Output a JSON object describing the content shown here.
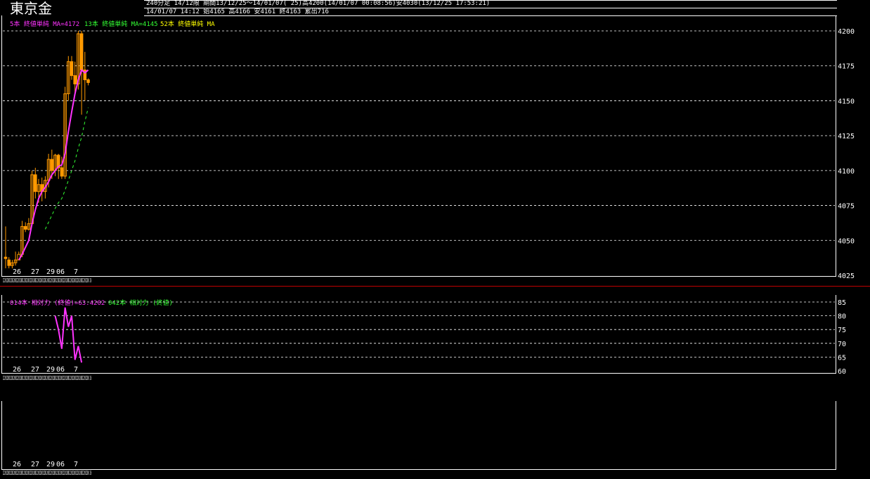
{
  "header": {
    "instrument": "東京金",
    "line1": "240分足 14/12限 期間13/12/25〜14/01/07( 25)高4200(14/01/07 00:08:56)安4030(13/12/25 17:53:21)",
    "line2": "14/01/07 14:12 始4165 高4166 安4161 終4163 累出716"
  },
  "legends": {
    "ma5": "5本 終値単純 MA=4172",
    "ma13": "13本 終値単純 MA=4145",
    "ma52": "52本 終値単純 MA",
    "rsi14": "014本 相対力 (終値)=63.4202",
    "rsi42": "042本 相対力 (終値)"
  },
  "colors": {
    "candle": "#ff9900",
    "ma5": "#ff33ff",
    "ma13": "#33ff33",
    "ma52": "#ffff00",
    "rsi14": "#ff33ff",
    "rsi42": "#33ff33",
    "grid": "#ffffff",
    "separator": "#c00000"
  },
  "date_labels": [
    "26",
    "27",
    "29",
    "06",
    "7"
  ],
  "time_labels": "12201208122012081220120812201208122012081220120812201208122012081220120812201208122012081220120812201208 26",
  "chart_data": [
    {
      "type": "candlestick",
      "title": "",
      "ylim": [
        4025,
        4210
      ],
      "yticks": [
        4025,
        4050,
        4075,
        4100,
        4125,
        4150,
        4175,
        4200
      ],
      "grid": true,
      "candles": [
        {
          "o": 4038,
          "h": 4060,
          "l": 4030,
          "c": 4037
        },
        {
          "o": 4036,
          "h": 4038,
          "l": 4030,
          "c": 4032
        },
        {
          "o": 4032,
          "h": 4036,
          "l": 4030,
          "c": 4034
        },
        {
          "o": 4034,
          "h": 4042,
          "l": 4032,
          "c": 4036
        },
        {
          "o": 4036,
          "h": 4042,
          "l": 4040,
          "c": 4040
        },
        {
          "o": 4040,
          "h": 4064,
          "l": 4038,
          "c": 4060
        },
        {
          "o": 4060,
          "h": 4063,
          "l": 4056,
          "c": 4058
        },
        {
          "o": 4058,
          "h": 4066,
          "l": 4057,
          "c": 4062
        },
        {
          "o": 4062,
          "h": 4100,
          "l": 4062,
          "c": 4097
        },
        {
          "o": 4097,
          "h": 4102,
          "l": 4080,
          "c": 4085
        },
        {
          "o": 4085,
          "h": 4094,
          "l": 4077,
          "c": 4090
        },
        {
          "o": 4090,
          "h": 4095,
          "l": 4078,
          "c": 4085
        },
        {
          "o": 4085,
          "h": 4096,
          "l": 4080,
          "c": 4093
        },
        {
          "o": 4093,
          "h": 4112,
          "l": 4088,
          "c": 4108
        },
        {
          "o": 4108,
          "h": 4115,
          "l": 4094,
          "c": 4100
        },
        {
          "o": 4100,
          "h": 4112,
          "l": 4096,
          "c": 4111
        },
        {
          "o": 4111,
          "h": 4112,
          "l": 4094,
          "c": 4102
        },
        {
          "o": 4102,
          "h": 4110,
          "l": 4094,
          "c": 4096
        },
        {
          "o": 4096,
          "h": 4160,
          "l": 4094,
          "c": 4155
        },
        {
          "o": 4155,
          "h": 4182,
          "l": 4150,
          "c": 4178
        },
        {
          "o": 4178,
          "h": 4182,
          "l": 4165,
          "c": 4168
        },
        {
          "o": 4168,
          "h": 4178,
          "l": 4155,
          "c": 4162
        },
        {
          "o": 4162,
          "h": 4200,
          "l": 4158,
          "c": 4198
        },
        {
          "o": 4198,
          "h": 4200,
          "l": 4140,
          "c": 4172
        },
        {
          "o": 4172,
          "h": 4185,
          "l": 4150,
          "c": 4165
        },
        {
          "o": 4165,
          "h": 4166,
          "l": 4161,
          "c": 4163
        }
      ],
      "series": [
        {
          "name": "5本 終値単純 MA",
          "values": [
            null,
            null,
            null,
            null,
            4036,
            4040,
            4045,
            4050,
            4062,
            4072,
            4080,
            4085,
            4088,
            4092,
            4097,
            4100,
            4103,
            4104,
            4112,
            4128,
            4142,
            4155,
            4165,
            4172,
            4170,
            4172
          ]
        },
        {
          "name": "13本 終値単純 MA",
          "values": [
            null,
            null,
            null,
            null,
            null,
            null,
            null,
            null,
            null,
            null,
            null,
            null,
            4058,
            4063,
            4068,
            4073,
            4077,
            4080,
            4086,
            4093,
            4100,
            4107,
            4116,
            4124,
            4135,
            4145
          ]
        }
      ]
    },
    {
      "type": "line",
      "title": "",
      "ylim": [
        60,
        85
      ],
      "yticks": [
        60,
        65,
        70,
        75,
        80,
        85
      ],
      "grid": true,
      "series": [
        {
          "name": "014本 相対力 (終値)",
          "values": [
            null,
            null,
            null,
            null,
            null,
            null,
            null,
            null,
            null,
            null,
            null,
            null,
            null,
            null,
            null,
            80,
            75,
            68,
            83,
            76,
            80,
            64,
            69,
            63
          ]
        }
      ]
    }
  ]
}
